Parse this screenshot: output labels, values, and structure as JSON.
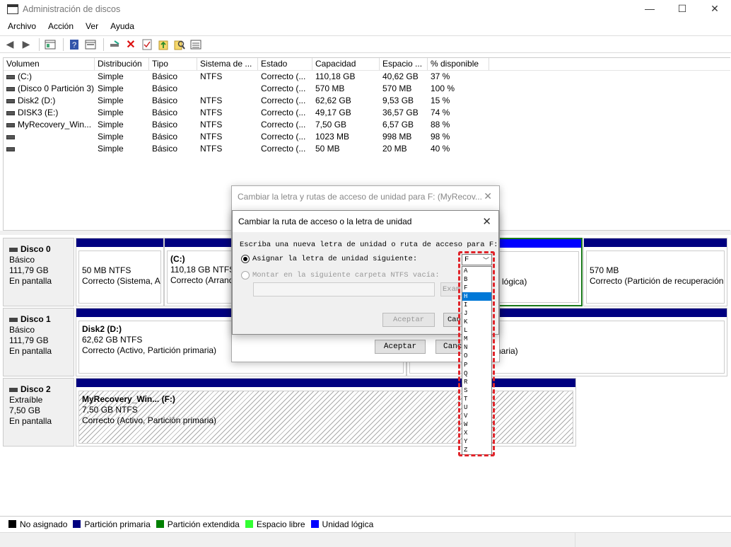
{
  "window": {
    "title": "Administración de discos",
    "minimize": "—",
    "maximize": "☐",
    "close": "✕"
  },
  "menu": [
    "Archivo",
    "Acción",
    "Ver",
    "Ayuda"
  ],
  "table": {
    "headers": [
      "Volumen",
      "Distribución",
      "Tipo",
      "Sistema de ...",
      "Estado",
      "Capacidad",
      "Espacio ...",
      "% disponible"
    ],
    "rows": [
      {
        "vol": "(C:)",
        "dist": "Simple",
        "tipo": "Básico",
        "fs": "NTFS",
        "estado": "Correcto (...",
        "cap": "110,18 GB",
        "esp": "40,62 GB",
        "pct": "37 %"
      },
      {
        "vol": "(Disco 0 Partición 3)",
        "dist": "Simple",
        "tipo": "Básico",
        "fs": "",
        "estado": "Correcto (...",
        "cap": "570 MB",
        "esp": "570 MB",
        "pct": "100 %"
      },
      {
        "vol": "Disk2 (D:)",
        "dist": "Simple",
        "tipo": "Básico",
        "fs": "NTFS",
        "estado": "Correcto (...",
        "cap": "62,62 GB",
        "esp": "9,53 GB",
        "pct": "15 %"
      },
      {
        "vol": "DISK3 (E:)",
        "dist": "Simple",
        "tipo": "Básico",
        "fs": "NTFS",
        "estado": "Correcto (...",
        "cap": "49,17 GB",
        "esp": "36,57 GB",
        "pct": "74 %"
      },
      {
        "vol": "MyRecovery_Win...",
        "dist": "Simple",
        "tipo": "Básico",
        "fs": "NTFS",
        "estado": "Correcto (...",
        "cap": "7,50 GB",
        "esp": "6,57 GB",
        "pct": "88 %"
      },
      {
        "vol": "",
        "dist": "Simple",
        "tipo": "Básico",
        "fs": "NTFS",
        "estado": "Correcto (...",
        "cap": "1023 MB",
        "esp": "998 MB",
        "pct": "98 %"
      },
      {
        "vol": "",
        "dist": "Simple",
        "tipo": "Básico",
        "fs": "NTFS",
        "estado": "Correcto (...",
        "cap": "50 MB",
        "esp": "20 MB",
        "pct": "40 %"
      }
    ]
  },
  "disks": {
    "d0": {
      "name": "Disco 0",
      "type": "Básico",
      "size": "111,79 GB",
      "status": "En pantalla",
      "p1": {
        "line1": "50 MB NTFS",
        "line2": "Correcto (Sistema, A"
      },
      "p2": {
        "title": "(C:)",
        "line1": "110,18 GB NTFS",
        "line2": "Correcto (Arranq"
      },
      "p3": {
        "line2": "lógica)"
      },
      "p4": {
        "line1": "570 MB",
        "line2": "Correcto (Partición de recuperación"
      }
    },
    "d1": {
      "name": "Disco 1",
      "type": "Básico",
      "size": "111,79 GB",
      "status": "En pantalla",
      "p1": {
        "title": "Disk2  (D:)",
        "line1": "62,62 GB NTFS",
        "line2": "Correcto (Activo, Partición primaria)"
      },
      "p2": {
        "line2": "rimaria)"
      }
    },
    "d2": {
      "name": "Disco 2",
      "type": "Extraíble",
      "size": "7,50 GB",
      "status": "En pantalla",
      "p1": {
        "title": "MyRecovery_Win... (F:)",
        "line1": "7,50 GB NTFS",
        "line2": "Correcto (Activo, Partición primaria)"
      }
    }
  },
  "legend": [
    {
      "label": "No asignado",
      "color": "#000000"
    },
    {
      "label": "Partición primaria",
      "color": "#000080"
    },
    {
      "label": "Partición extendida",
      "color": "#008000"
    },
    {
      "label": "Espacio libre",
      "color": "#33ff33"
    },
    {
      "label": "Unidad lógica",
      "color": "#0000ff"
    }
  ],
  "dialog_back": {
    "title": "Cambiar la letra y rutas de acceso de unidad para F: (MyRecov...",
    "ok": "Aceptar",
    "cancel": "Canc"
  },
  "dialog": {
    "title": "Cambiar la ruta de acceso o la letra de unidad",
    "instruction": "Escriba una nueva letra de unidad o ruta de acceso para F:",
    "radio1": "Asignar la letra de unidad siguiente:",
    "radio2": "Montar en la siguiente carpeta NTFS vacía:",
    "browse": "Exam",
    "ok": "Aceptar",
    "cancel": "Can",
    "selected_letter": "F",
    "letters": [
      "A",
      "B",
      "F",
      "H",
      "I",
      "J",
      "K",
      "L",
      "M",
      "N",
      "O",
      "P",
      "Q",
      "R",
      "S",
      "T",
      "U",
      "V",
      "W",
      "X",
      "Y",
      "Z"
    ],
    "highlighted": "H"
  }
}
